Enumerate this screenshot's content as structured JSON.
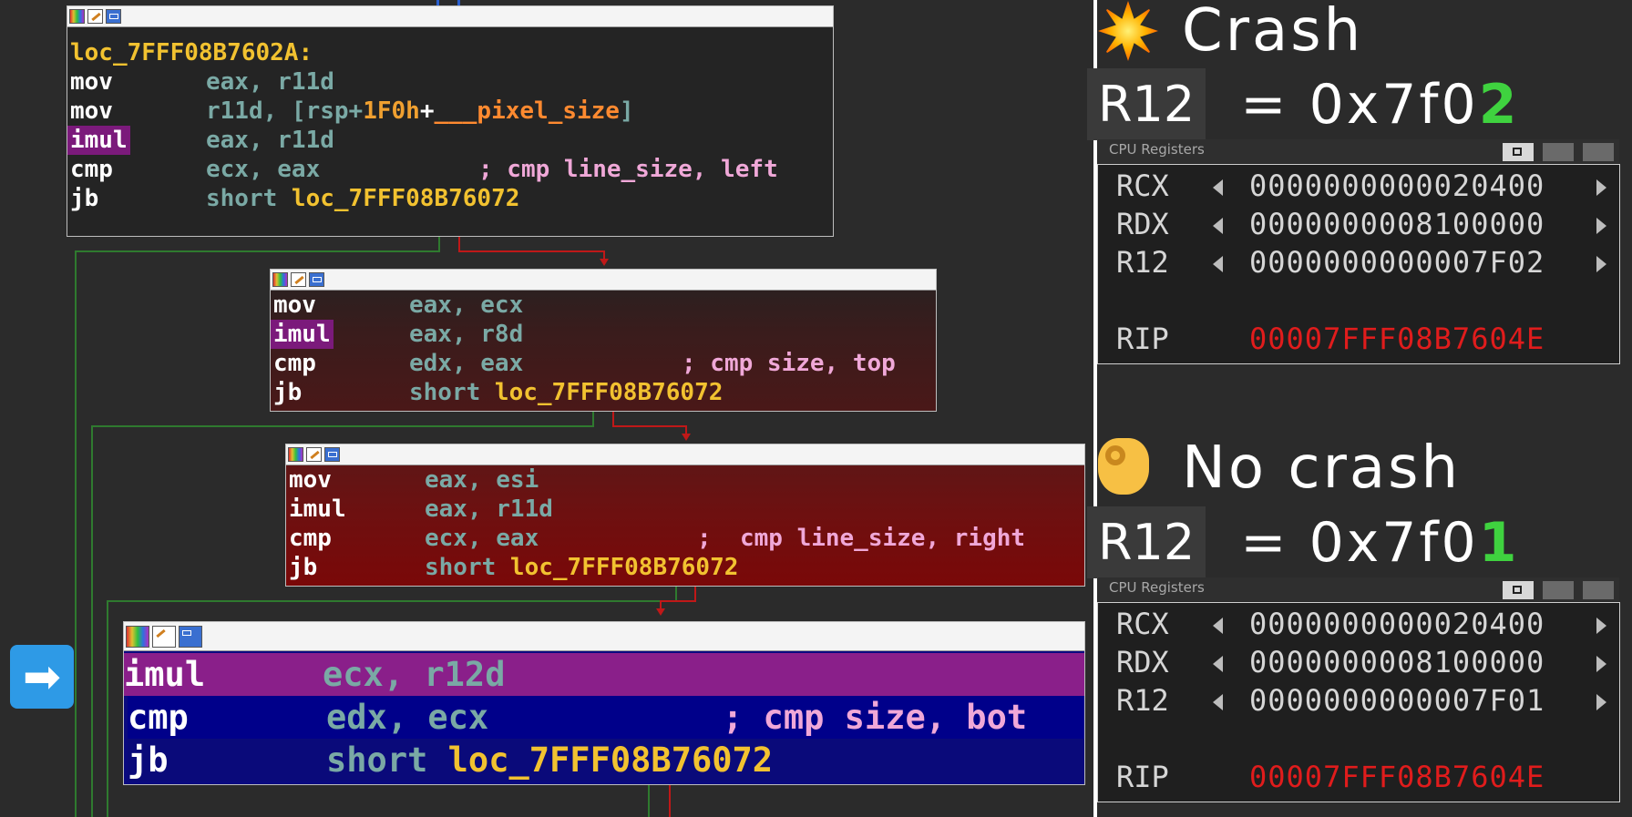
{
  "blocks": [
    {
      "label": "loc_7FFF08B7602A:",
      "lines": [
        {
          "mn": "mov",
          "op": [
            {
              "t": "eax, r11d",
              "c": "reg"
            }
          ]
        },
        {
          "mn": "mov",
          "op": [
            {
              "t": "r11d, [rsp+",
              "c": "reg"
            },
            {
              "t": "1F0h",
              "c": "num"
            },
            {
              "t": "+",
              "c": "plain"
            },
            {
              "t": "___pixel_size",
              "c": "sym"
            },
            {
              "t": "]",
              "c": "reg"
            }
          ]
        },
        {
          "mn": "imul",
          "hl": true,
          "op": [
            {
              "t": "eax, r11d",
              "c": "reg"
            }
          ]
        },
        {
          "mn": "cmp",
          "op": [
            {
              "t": "ecx, eax",
              "c": "reg"
            }
          ],
          "comment": "; cmp line_size, left"
        },
        {
          "mn": "jb",
          "op": [
            {
              "t": "short ",
              "c": "reg"
            },
            {
              "t": "loc_7FFF08B76072",
              "c": "lbl"
            }
          ]
        }
      ]
    },
    {
      "lines": [
        {
          "mn": "mov",
          "op": [
            {
              "t": "eax, ecx",
              "c": "reg"
            }
          ]
        },
        {
          "mn": "imul",
          "hl": true,
          "op": [
            {
              "t": "eax, r8d",
              "c": "reg"
            }
          ]
        },
        {
          "mn": "cmp",
          "op": [
            {
              "t": "edx, eax",
              "c": "reg"
            }
          ],
          "comment": "; cmp size, top"
        },
        {
          "mn": "jb",
          "op": [
            {
              "t": "short ",
              "c": "reg"
            },
            {
              "t": "loc_7FFF08B76072",
              "c": "lbl"
            }
          ]
        }
      ]
    },
    {
      "lines": [
        {
          "mn": "mov",
          "op": [
            {
              "t": "eax, esi",
              "c": "reg"
            }
          ]
        },
        {
          "mn": "imul",
          "op": [
            {
              "t": "eax, r11d",
              "c": "reg"
            }
          ]
        },
        {
          "mn": "cmp",
          "op": [
            {
              "t": "ecx, eax",
              "c": "reg"
            }
          ],
          "comment": ";  cmp line_size, right"
        },
        {
          "mn": "jb",
          "op": [
            {
              "t": "short ",
              "c": "reg"
            },
            {
              "t": "loc_7FFF08B76072",
              "c": "lbl"
            }
          ]
        }
      ]
    },
    {
      "lines": [
        {
          "mn": "imul",
          "op": [
            {
              "t": "ecx, r12d",
              "c": "reg"
            }
          ]
        },
        {
          "mn": "cmp",
          "op": [
            {
              "t": "edx, ecx",
              "c": "reg"
            }
          ],
          "comment": "; cmp size, bot"
        },
        {
          "mn": "jb",
          "op": [
            {
              "t": "short ",
              "c": "reg"
            },
            {
              "t": "loc_7FFF08B76072",
              "c": "lbl"
            }
          ]
        }
      ]
    }
  ],
  "nav_arrow": "➡",
  "crash": {
    "heading": "Crash",
    "reg": "R12",
    "expr_prefix": "= 0x7f0",
    "expr_digit": "2",
    "window_title": "CPU Registers",
    "registers": [
      {
        "name": "RCX",
        "value": "0000000000020400"
      },
      {
        "name": "RDX",
        "value": "0000000008100000"
      },
      {
        "name": "R12",
        "value": "0000000000007F02"
      },
      {
        "name": "RIP",
        "value": "00007FFF08B7604E"
      }
    ]
  },
  "nocrash": {
    "heading": "No crash",
    "reg": "R12",
    "expr_prefix": "= 0x7f0",
    "expr_digit": "1",
    "window_title": "CPU Registers",
    "registers": [
      {
        "name": "RCX",
        "value": "0000000000020400"
      },
      {
        "name": "RDX",
        "value": "0000000008100000"
      },
      {
        "name": "R12",
        "value": "0000000000007F01"
      },
      {
        "name": "RIP",
        "value": "00007FFF08B7604E"
      }
    ]
  }
}
